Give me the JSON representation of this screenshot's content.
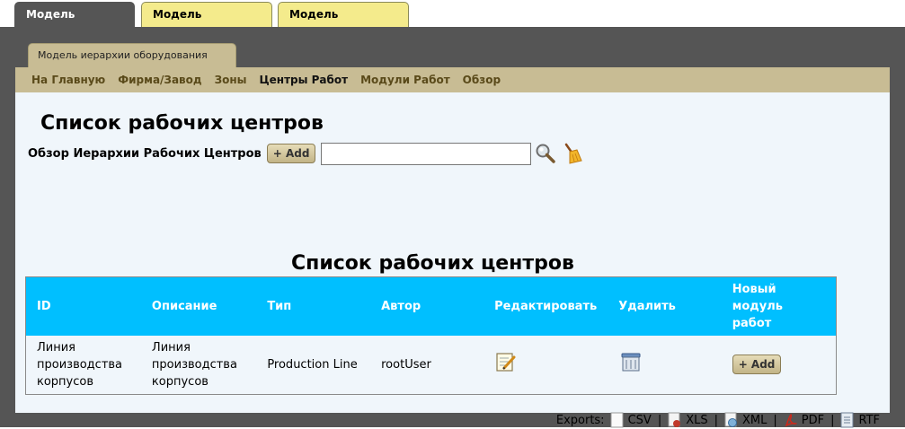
{
  "top_tabs": [
    {
      "label": "Модель домена",
      "active": true
    },
    {
      "label": "Модель ресурсов",
      "active": false
    },
    {
      "label": "Модель сегмента",
      "active": false
    }
  ],
  "inner_tab": {
    "label": "Модель иерархии оборудования"
  },
  "subnav": [
    "На Главную",
    "Фирма/Завод",
    "Зоны",
    "Центры Работ",
    "Модули Работ",
    "Обзор"
  ],
  "page": {
    "title": "Список рабочих центров",
    "search_label": "Обзор Иерархии Рабочих Центров",
    "add_label": "+ Add",
    "search_value": ""
  },
  "table": {
    "title": "Список рабочих центров",
    "headers": [
      "ID",
      "Описание",
      "Тип",
      "Автор",
      "Редактировать",
      "Удалить",
      "Новый модуль работ"
    ],
    "rows": [
      {
        "id": "Линия производства корпусов",
        "description": "Линия производства корпусов",
        "type": "Production Line",
        "author": "rootUser",
        "new_module_label": "+ Add"
      }
    ]
  },
  "exports": {
    "label": "Exports:",
    "items": [
      "CSV",
      "XLS",
      "XML",
      "PDF",
      "RTF"
    ],
    "separator": "|"
  },
  "colors": {
    "frame": "#555555",
    "active_tab": "#555555",
    "inactive_tab": "#f4eb8c",
    "subnav": "#c8bc94",
    "table_header": "#00bfff",
    "content_bg": "#f0f6fb"
  }
}
